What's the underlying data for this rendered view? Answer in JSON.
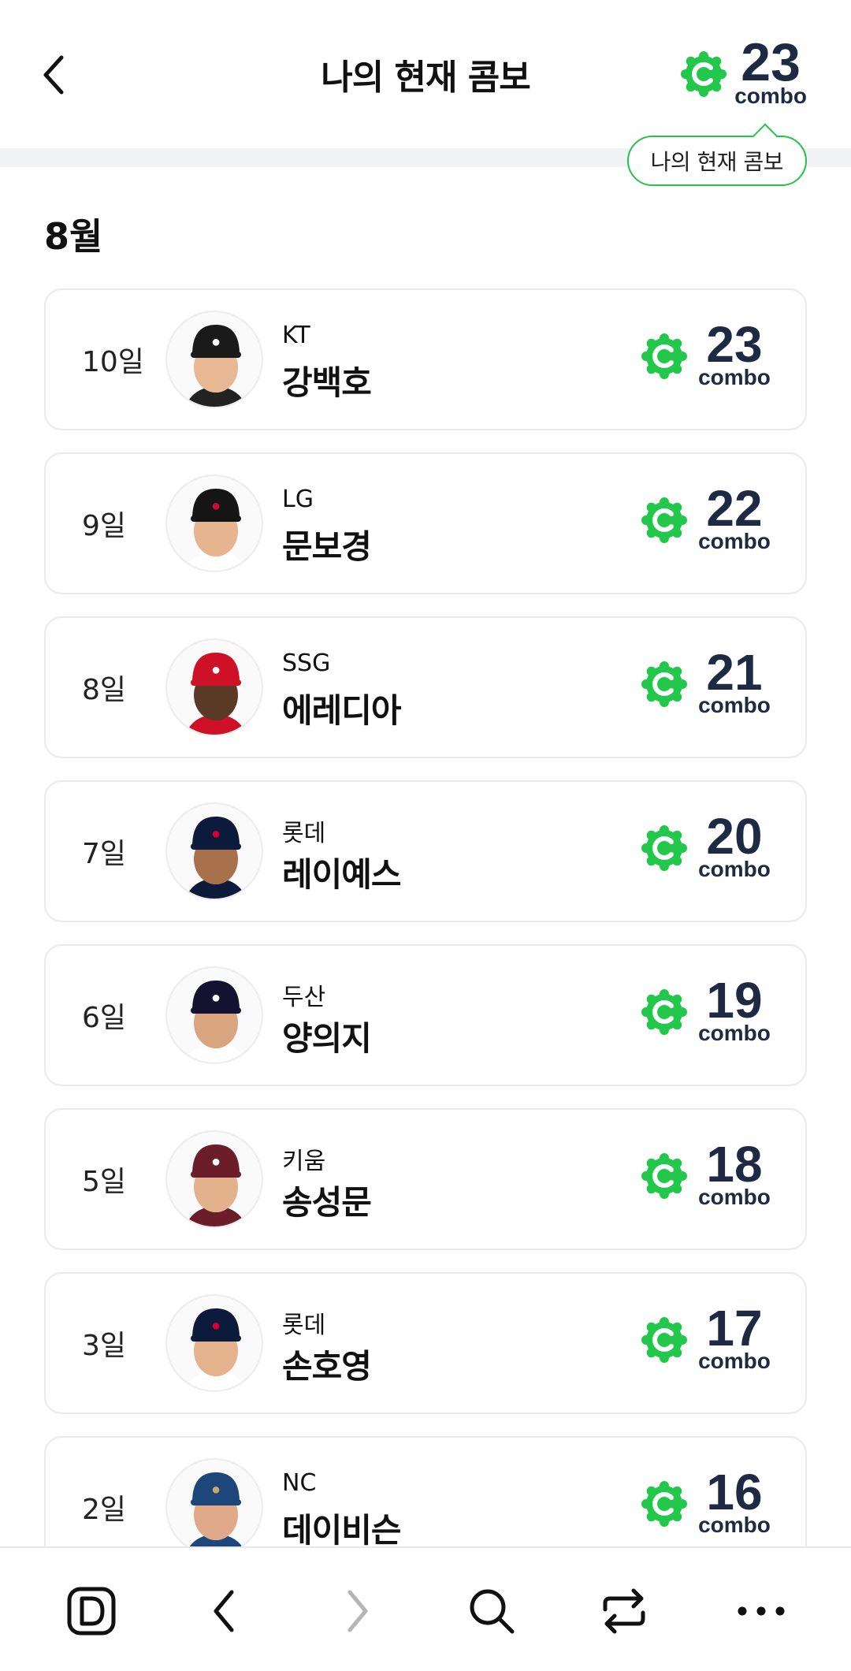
{
  "header": {
    "title": "나의 현재 콤보",
    "combo_count": "23",
    "combo_label": "combo",
    "tooltip": "나의 현재 콤보"
  },
  "month": "8월",
  "colors": {
    "accent": "#27c24c",
    "badge": "#22c84a",
    "number": "#1e2a44",
    "border": "#e8eaed"
  },
  "entries": [
    {
      "day": "10일",
      "team": "KT",
      "name": "강백호",
      "combo": "23",
      "combo_label": "combo",
      "cap": "#1a1a1a",
      "cap_logo": "#ffffff",
      "skin": "#e8b894",
      "shirt": "#222222"
    },
    {
      "day": "9일",
      "team": "LG",
      "name": "문보경",
      "combo": "22",
      "combo_label": "combo",
      "cap": "#151515",
      "cap_logo": "#c8102e",
      "skin": "#e6b48e",
      "shirt": "#ffffff"
    },
    {
      "day": "8일",
      "team": "SSG",
      "name": "에레디아",
      "combo": "21",
      "combo_label": "combo",
      "cap": "#ce1126",
      "cap_logo": "#ffffff",
      "skin": "#5a3a26",
      "shirt": "#ce1126"
    },
    {
      "day": "7일",
      "team": "롯데",
      "name": "레이예스",
      "combo": "20",
      "combo_label": "combo",
      "cap": "#0c1a3c",
      "cap_logo": "#d50032",
      "skin": "#a8714c",
      "shirt": "#0c1a3c"
    },
    {
      "day": "6일",
      "team": "두산",
      "name": "양의지",
      "combo": "19",
      "combo_label": "combo",
      "cap": "#131230",
      "cap_logo": "#ffffff",
      "skin": "#d9a57e",
      "shirt": "#ffffff"
    },
    {
      "day": "5일",
      "team": "키움",
      "name": "송성문",
      "combo": "18",
      "combo_label": "combo",
      "cap": "#6b1d2a",
      "cap_logo": "#ffffff",
      "skin": "#e3b18b",
      "shirt": "#6b1d2a"
    },
    {
      "day": "3일",
      "team": "롯데",
      "name": "손호영",
      "combo": "17",
      "combo_label": "combo",
      "cap": "#0c1a3c",
      "cap_logo": "#d50032",
      "skin": "#e4b28c",
      "shirt": "#ffffff"
    },
    {
      "day": "2일",
      "team": "NC",
      "name": "데이비슨",
      "combo": "16",
      "combo_label": "combo",
      "cap": "#1d467a",
      "cap_logo": "#c7a76b",
      "skin": "#e0a98a",
      "shirt": "#1d467a"
    }
  ],
  "toolbar": {
    "icons": [
      "app-home-icon",
      "back-icon",
      "forward-icon",
      "search-icon",
      "share-icon",
      "more-icon"
    ]
  }
}
